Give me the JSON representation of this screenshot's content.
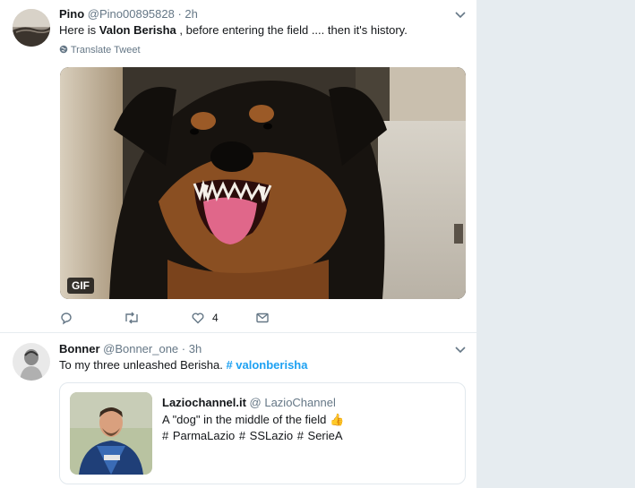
{
  "tweet1": {
    "name": "Pino",
    "handle": "@Pino00895828",
    "time": "· 2h",
    "text_before": "Here is ",
    "text_bold": "Valon Berisha",
    "text_after": " , before entering the field .... then it's history.",
    "translate_label": "Translate Tweet",
    "media_badge": "GIF",
    "like_count": "4"
  },
  "tweet2": {
    "name": "Bonner",
    "handle": "@Bonner_one",
    "time": "· 3h",
    "text_before": "To my three unleashed Berisha. ",
    "hashtag": "# valonberisha",
    "quoted": {
      "name": "Laziochannel.it",
      "handle": "@ LazioChannel",
      "text": "A \"dog\" in the middle of the field ",
      "emoji": "👍",
      "tags": "# ParmaLazio  # SSLazio  # SerieA"
    }
  },
  "colors": {
    "link": "#1da1f2",
    "secondary_text": "#657786",
    "background": "#e6ecf0"
  }
}
